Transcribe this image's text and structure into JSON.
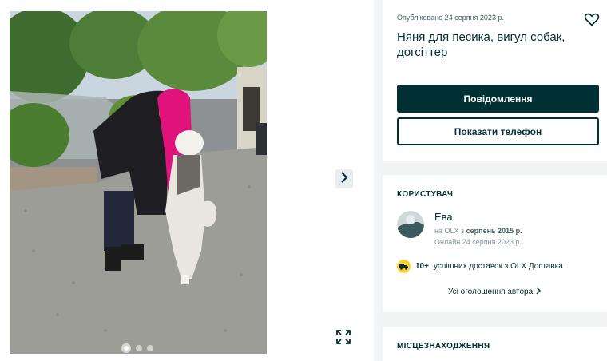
{
  "gallery": {
    "photo_alt": "",
    "slide_count": 3,
    "active_slide": 1,
    "icons": {
      "next": "chevron-right-icon",
      "expand": "expand-icon"
    }
  },
  "ad": {
    "published": "Опубліковано 24 серпня 2023 р.",
    "title": "Няня для песика, вигул собак, догсіттер",
    "message_button": "Повідомлення",
    "phone_button": "Показати телефон",
    "favorite_icon": "heart-icon"
  },
  "user": {
    "section_title": "КОРИСТУВАЧ",
    "name": "Ева",
    "since_prefix": "на OLX з",
    "since_value": "серпень 2015 р.",
    "online": "Онлайн 24 серпня 2023 р.",
    "delivery_count": "10+",
    "delivery_text": "успішних доставок з OLX Доставка",
    "all_ads": "Усі оголошення автора"
  },
  "location": {
    "section_title": "МІСЦЕЗНАХОДЖЕННЯ"
  },
  "colors": {
    "primary": "#002f34",
    "page_bg": "#f2f4f5",
    "delivery_badge": "#ffce32"
  }
}
